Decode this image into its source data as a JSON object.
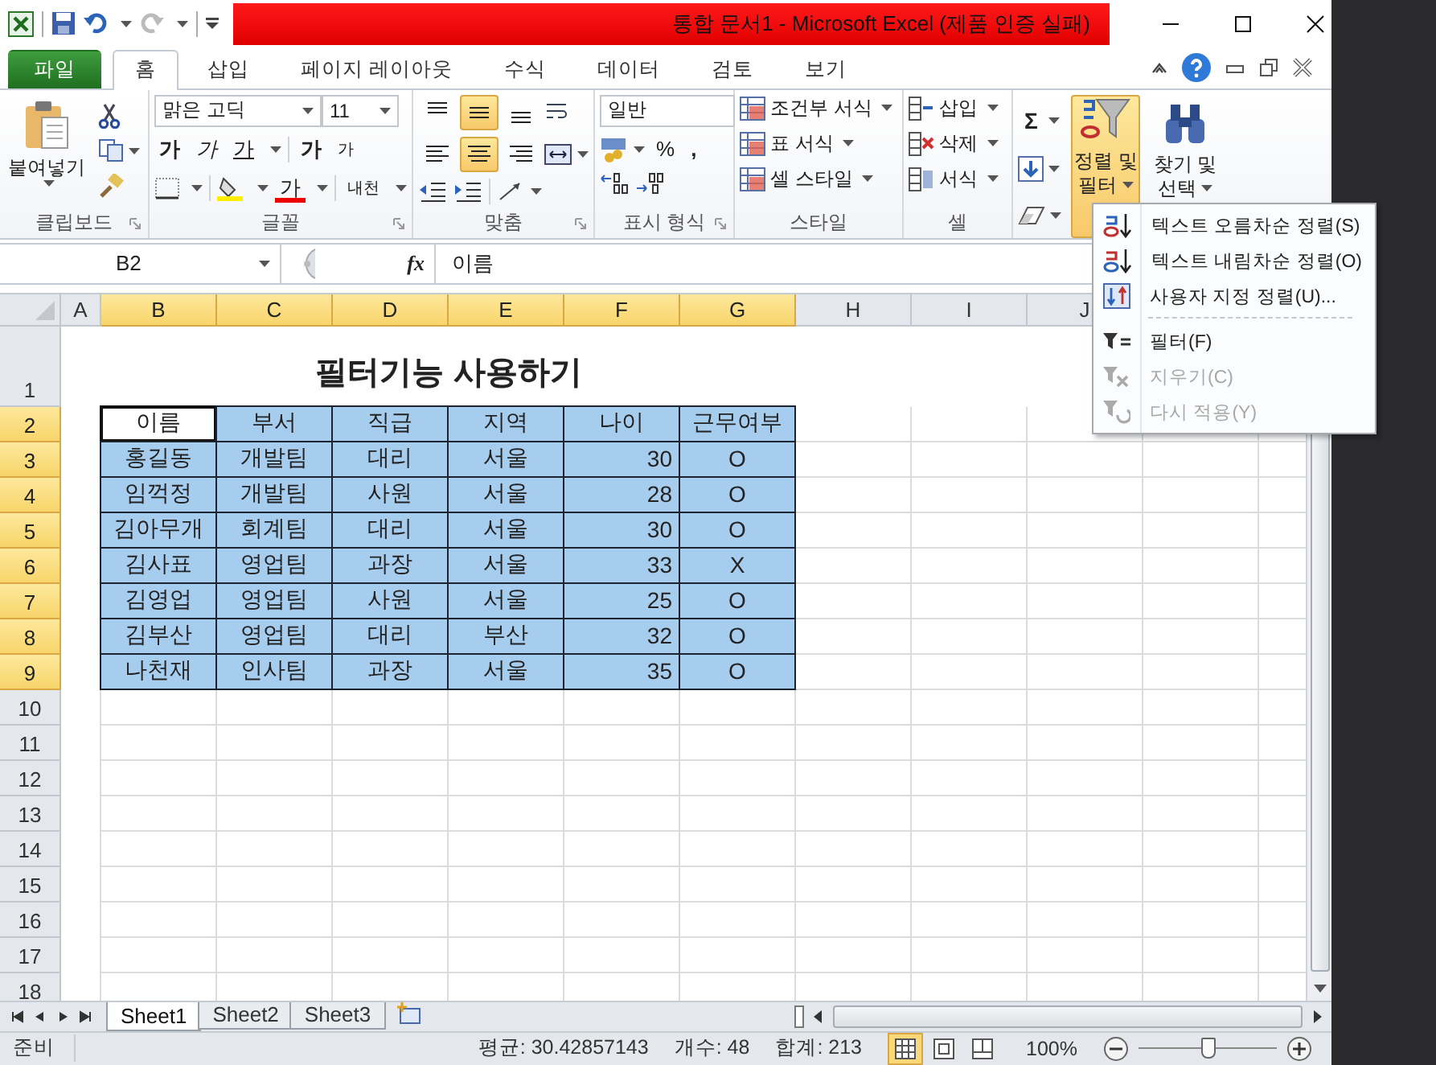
{
  "title_bar": {
    "title": "통합 문서1  -  Microsoft Excel (제품 인증 실패)"
  },
  "ribbon_tabs": [
    {
      "label": "파일",
      "kind": "file",
      "selected": false
    },
    {
      "label": "홈",
      "kind": "tab",
      "selected": true
    },
    {
      "label": "삽입",
      "kind": "tab",
      "selected": false
    },
    {
      "label": "페이지 레이아웃",
      "kind": "tab",
      "selected": false
    },
    {
      "label": "수식",
      "kind": "tab",
      "selected": false
    },
    {
      "label": "데이터",
      "kind": "tab",
      "selected": false
    },
    {
      "label": "검토",
      "kind": "tab",
      "selected": false
    },
    {
      "label": "보기",
      "kind": "tab",
      "selected": false
    }
  ],
  "clipboard": {
    "group": "클립보드",
    "paste": "붙여넣기"
  },
  "font": {
    "group": "글꼴",
    "name": "맑은 고딕",
    "size": "11",
    "bold": "가",
    "italic": "가",
    "underline": "가",
    "grow": "가",
    "shrink": "가",
    "text_color": "가",
    "phonetic": "내천"
  },
  "alignment": {
    "group": "맞춤",
    "vertical": [
      {
        "kind": "top",
        "selected": false
      },
      {
        "kind": "middle",
        "selected": true
      },
      {
        "kind": "bottom",
        "selected": false
      }
    ],
    "horizontal": [
      {
        "kind": "left",
        "selected": false
      },
      {
        "kind": "center",
        "selected": true
      },
      {
        "kind": "right",
        "selected": false
      }
    ]
  },
  "number": {
    "group": "표시 형식",
    "format": "일반",
    "percent": "%",
    "comma": ","
  },
  "styles": {
    "group": "스타일",
    "items": [
      "조건부 서식",
      "표 서식",
      "셀 스타일"
    ]
  },
  "cells": {
    "group": "셀",
    "items": [
      "삽입",
      "삭제",
      "서식"
    ]
  },
  "editing": {
    "sum": "Σ",
    "sort_filter": {
      "lines": [
        "정렬 및",
        "필터"
      ],
      "pressed": true
    },
    "find": {
      "lines": [
        "찾기 및",
        "선택"
      ]
    }
  },
  "formula_bar": {
    "name_box": "B2",
    "fx": "fx",
    "value": "이름"
  },
  "columns": [
    {
      "label": "A",
      "selected": false
    },
    {
      "label": "B",
      "selected": true
    },
    {
      "label": "C",
      "selected": true
    },
    {
      "label": "D",
      "selected": true
    },
    {
      "label": "E",
      "selected": true
    },
    {
      "label": "F",
      "selected": true
    },
    {
      "label": "G",
      "selected": true
    },
    {
      "label": "H",
      "selected": false
    },
    {
      "label": "I",
      "selected": false
    },
    {
      "label": "J",
      "selected": false
    }
  ],
  "rows": [
    {
      "label": "1",
      "selected": false
    },
    {
      "label": "2",
      "selected": true
    },
    {
      "label": "3",
      "selected": true
    },
    {
      "label": "4",
      "selected": true
    },
    {
      "label": "5",
      "selected": true
    },
    {
      "label": "6",
      "selected": true
    },
    {
      "label": "7",
      "selected": true
    },
    {
      "label": "8",
      "selected": true
    },
    {
      "label": "9",
      "selected": true
    },
    {
      "label": "10",
      "selected": false
    },
    {
      "label": "11",
      "selected": false
    },
    {
      "label": "12",
      "selected": false
    },
    {
      "label": "13",
      "selected": false
    },
    {
      "label": "14",
      "selected": false
    },
    {
      "label": "15",
      "selected": false
    },
    {
      "label": "16",
      "selected": false
    },
    {
      "label": "17",
      "selected": false
    },
    {
      "label": "18",
      "selected": false
    }
  ],
  "sheet": {
    "title": "필터기능 사용하기",
    "fields": [
      {
        "label": "이름",
        "kind": "text",
        "active": true
      },
      {
        "label": "부서",
        "kind": "text",
        "active": false
      },
      {
        "label": "직급",
        "kind": "text",
        "active": false
      },
      {
        "label": "지역",
        "kind": "text",
        "active": false
      },
      {
        "label": "나이",
        "kind": "number",
        "active": false
      },
      {
        "label": "근무여부",
        "kind": "text",
        "active": false
      }
    ],
    "records": [
      [
        "홍길동",
        "개발팀",
        "대리",
        "서울",
        "30",
        "O"
      ],
      [
        "임꺽정",
        "개발팀",
        "사원",
        "서울",
        "28",
        "O"
      ],
      [
        "김아무개",
        "회계팀",
        "대리",
        "서울",
        "30",
        "O"
      ],
      [
        "김사표",
        "영업팀",
        "과장",
        "서울",
        "33",
        "X"
      ],
      [
        "김영업",
        "영업팀",
        "사원",
        "서울",
        "25",
        "O"
      ],
      [
        "김부산",
        "영업팀",
        "대리",
        "부산",
        "32",
        "O"
      ],
      [
        "나천재",
        "인사팀",
        "과장",
        "서울",
        "35",
        "O"
      ]
    ]
  },
  "sort_menu": [
    {
      "label": "텍스트 오름차순 정렬(S)",
      "kind": "sort-asc",
      "disabled": false
    },
    {
      "label": "텍스트 내림차순 정렬(O)",
      "kind": "sort-desc",
      "disabled": false
    },
    {
      "label": "사용자 지정 정렬(U)...",
      "kind": "custom-sort",
      "disabled": false
    },
    {
      "kind": "separator"
    },
    {
      "label": "필터(F)",
      "kind": "filter",
      "disabled": false
    },
    {
      "label": "지우기(C)",
      "kind": "clear",
      "disabled": true
    },
    {
      "label": "다시 적용(Y)",
      "kind": "reapply",
      "disabled": true
    }
  ],
  "sheet_tabs": [
    {
      "label": "Sheet1",
      "selected": true
    },
    {
      "label": "Sheet2",
      "selected": false
    },
    {
      "label": "Sheet3",
      "selected": false
    }
  ],
  "status_bar": {
    "mode": "준비",
    "average": "평균: 30.42857143",
    "count": "개수: 48",
    "sum": "합계: 213",
    "zoom": "100%",
    "zoom_slider": {
      "level": 0.5
    }
  }
}
